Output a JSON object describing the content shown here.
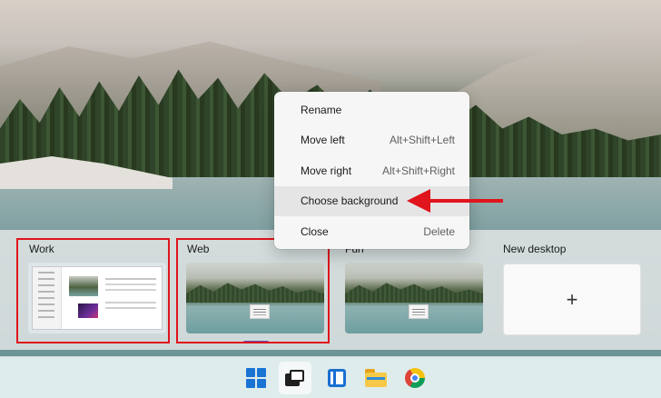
{
  "context_menu": {
    "items": [
      {
        "label": "Rename",
        "shortcut": ""
      },
      {
        "label": "Move left",
        "shortcut": "Alt+Shift+Left"
      },
      {
        "label": "Move right",
        "shortcut": "Alt+Shift+Right"
      },
      {
        "label": "Choose background",
        "shortcut": ""
      },
      {
        "label": "Close",
        "shortcut": "Delete"
      }
    ],
    "highlighted": "Choose background"
  },
  "desktops": [
    {
      "label": "Work"
    },
    {
      "label": "Web"
    },
    {
      "label": "Fun"
    },
    {
      "label": "New desktop",
      "icon": "plus-icon"
    }
  ],
  "taskbar": {
    "icons": [
      "windows-start-icon",
      "task-view-icon",
      "widgets-icon",
      "file-explorer-icon",
      "chrome-icon"
    ],
    "active": "task-view-icon"
  },
  "annotations": {
    "highlight_color": "#e0141c",
    "accent": "#5d4fb6"
  }
}
